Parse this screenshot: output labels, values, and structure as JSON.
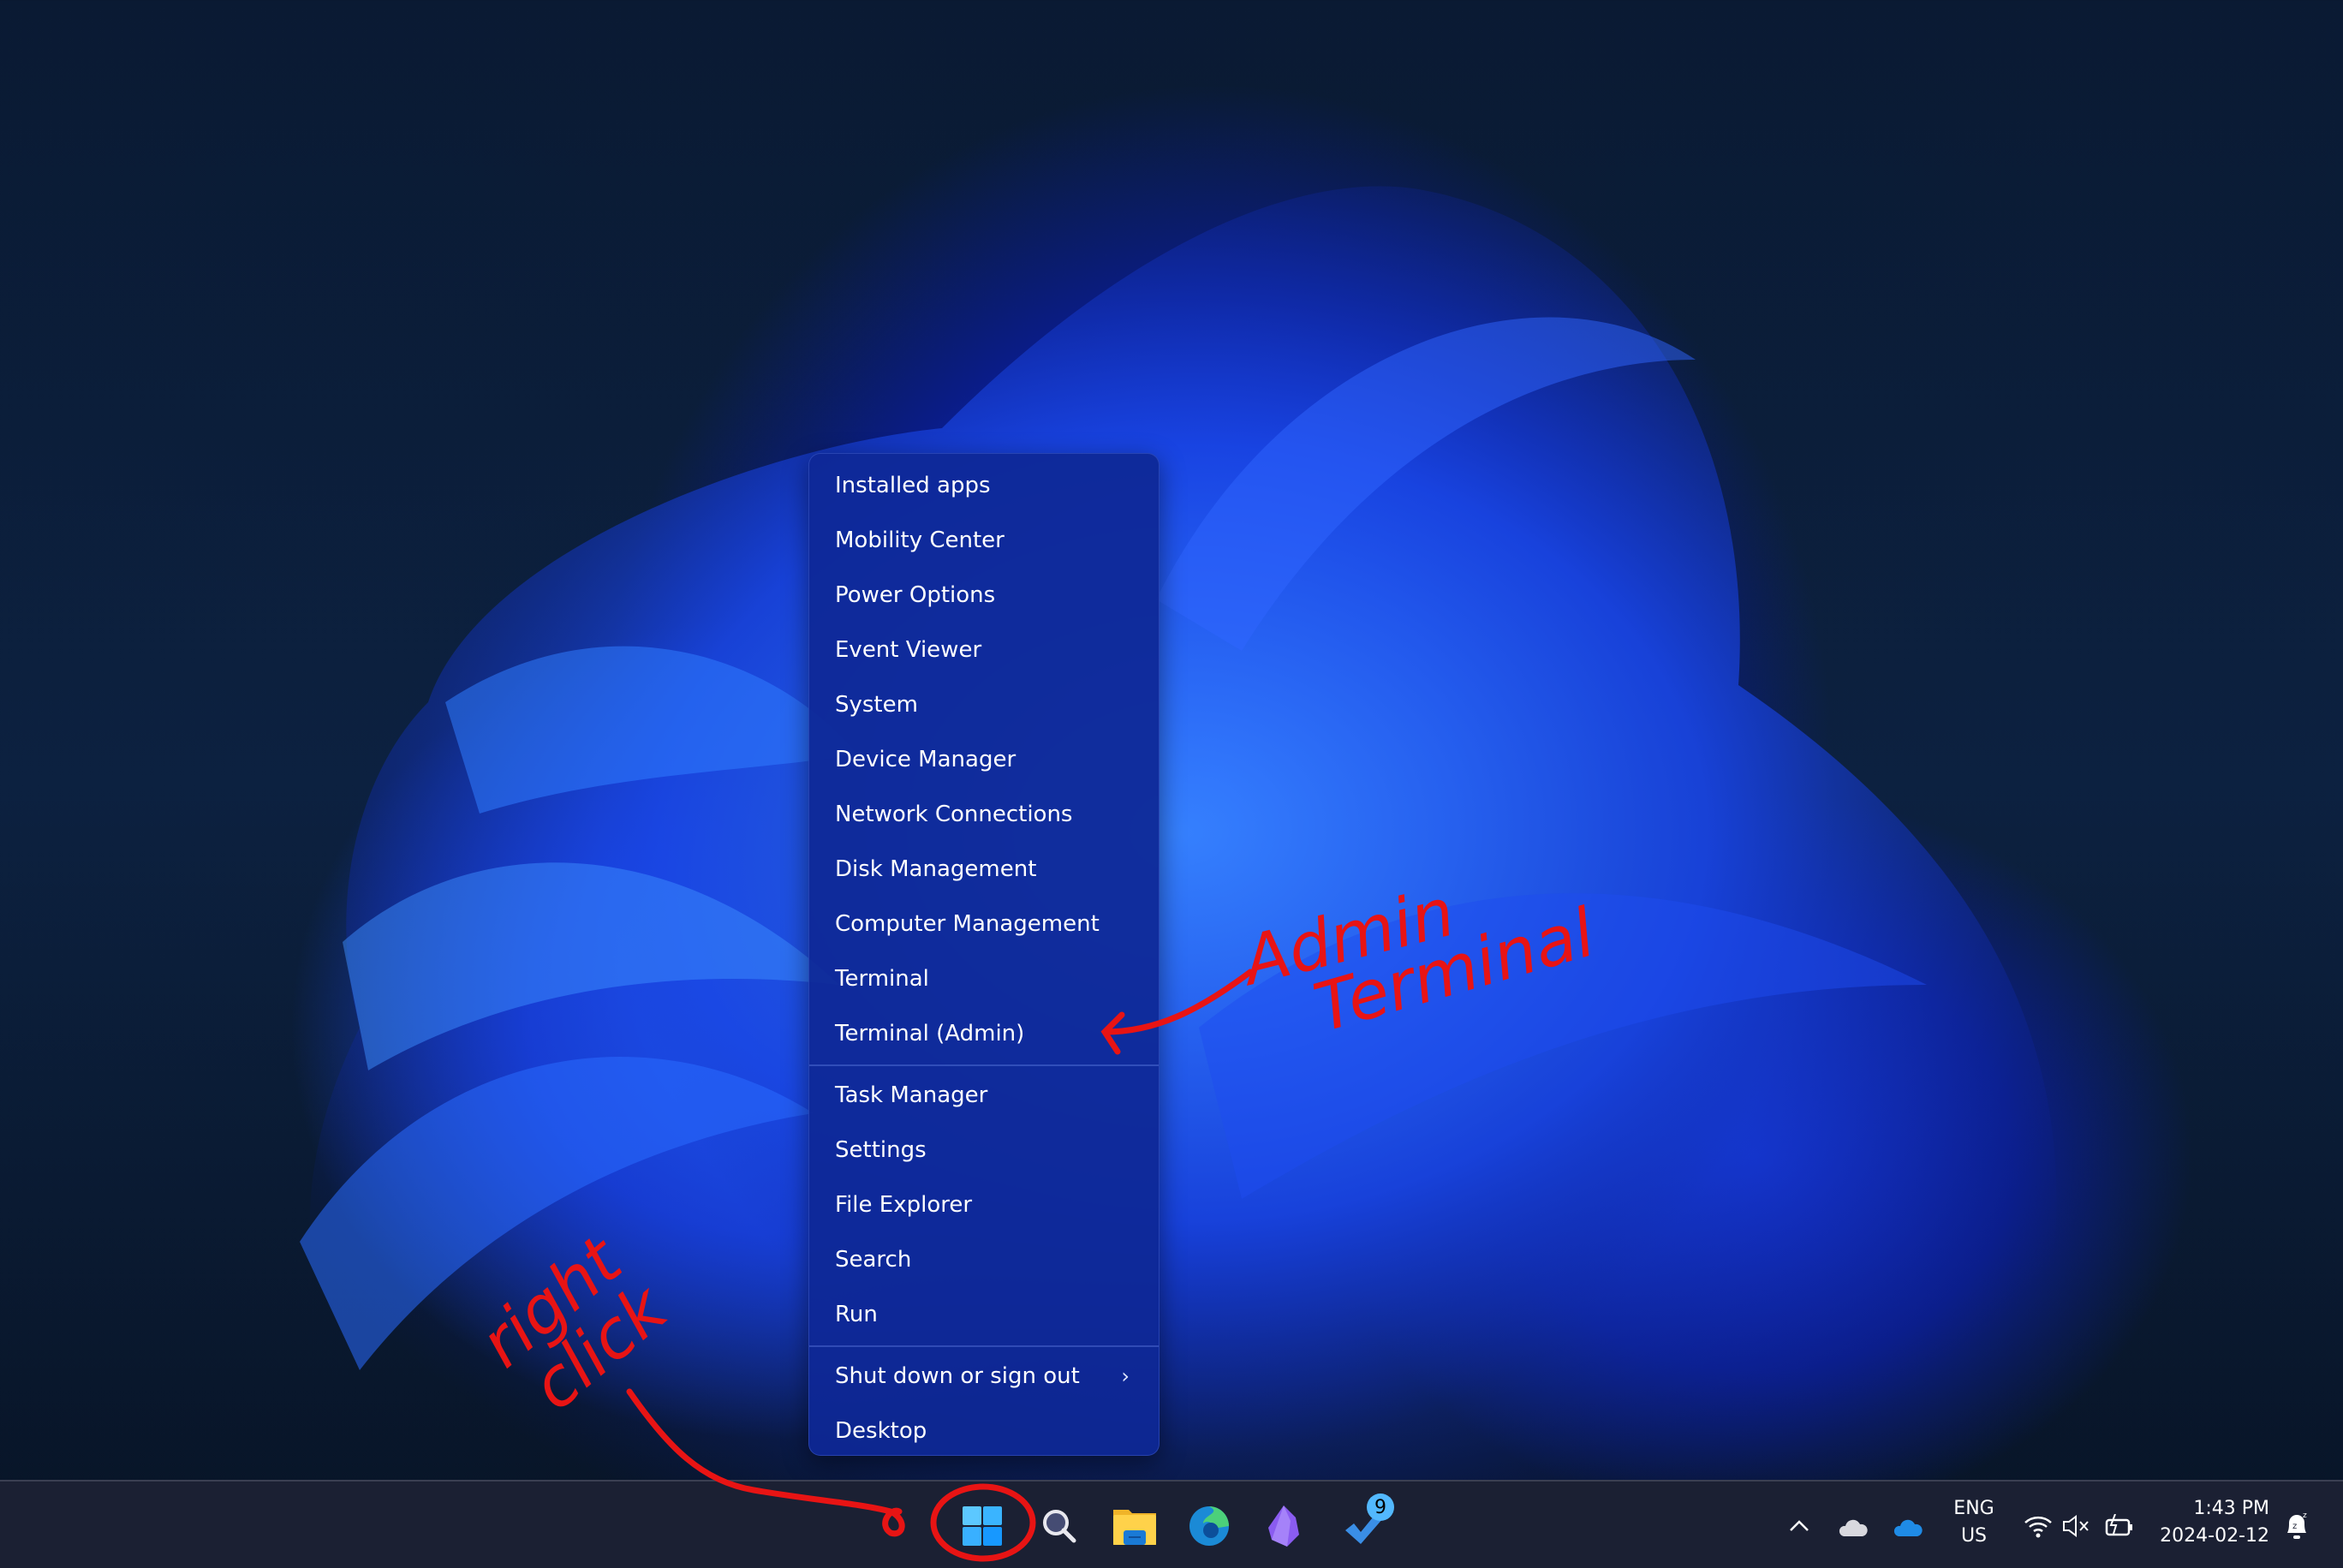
{
  "context_menu": {
    "groups": [
      {
        "items": [
          {
            "label": "Installed apps"
          },
          {
            "label": "Mobility Center"
          },
          {
            "label": "Power Options"
          },
          {
            "label": "Event Viewer"
          },
          {
            "label": "System"
          },
          {
            "label": "Device Manager"
          },
          {
            "label": "Network Connections"
          },
          {
            "label": "Disk Management"
          },
          {
            "label": "Computer Management"
          },
          {
            "label": "Terminal"
          },
          {
            "label": "Terminal (Admin)"
          }
        ]
      },
      {
        "items": [
          {
            "label": "Task Manager"
          },
          {
            "label": "Settings"
          },
          {
            "label": "File Explorer"
          },
          {
            "label": "Search"
          },
          {
            "label": "Run"
          }
        ]
      },
      {
        "items": [
          {
            "label": "Shut down or sign out",
            "submenu_icon": "chevron-right-icon"
          },
          {
            "label": "Desktop"
          }
        ]
      }
    ]
  },
  "taskbar": {
    "apps": [
      {
        "name": "start",
        "icon": "windows-logo-icon"
      },
      {
        "name": "search",
        "icon": "search-icon"
      },
      {
        "name": "file-explorer",
        "icon": "folder-icon"
      },
      {
        "name": "edge",
        "icon": "edge-icon"
      },
      {
        "name": "obsidian",
        "icon": "obsidian-icon"
      },
      {
        "name": "todo",
        "icon": "todo-check-icon",
        "badge": "9"
      }
    ],
    "tray": {
      "language": "ENG",
      "region": "US",
      "time": "1:43 PM",
      "date": "2024-02-12"
    }
  },
  "annotations": {
    "color": "#e81414",
    "menu_note_line1": "Admin",
    "menu_note_line2": "Terminal",
    "start_note_line1": "right",
    "start_note_line2": "click"
  }
}
